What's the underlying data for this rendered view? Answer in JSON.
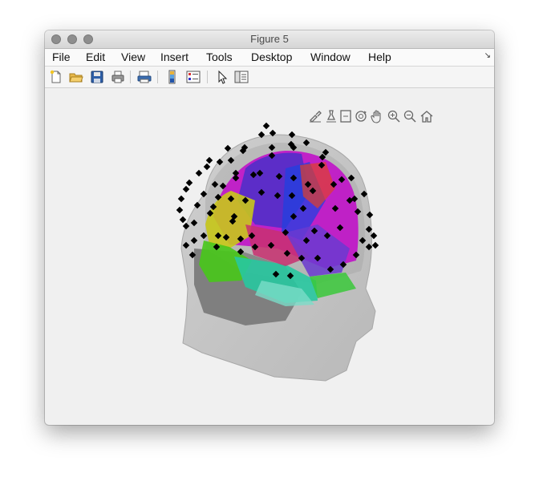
{
  "window": {
    "title": "Figure 5"
  },
  "menu": [
    "File",
    "Edit",
    "View",
    "Insert",
    "Tools",
    "Desktop",
    "Window",
    "Help"
  ],
  "toolbar_icons": [
    "new-figure-icon",
    "open-file-icon",
    "save-icon",
    "print-icon",
    "print-preview-icon",
    "colorbar-icon",
    "legend-icon",
    "edit-plot-arrow-icon",
    "property-inspector-icon"
  ],
  "axes_toolbar_icons": [
    "brush-icon",
    "data-cursor-icon",
    "insert-legend-icon",
    "rotate-3d-icon",
    "pan-hand-icon",
    "zoom-in-icon",
    "zoom-out-icon",
    "home-icon"
  ],
  "colors": {
    "background": "#f0f0f0",
    "electrode": "#000000",
    "head": "#c8c8c8"
  }
}
